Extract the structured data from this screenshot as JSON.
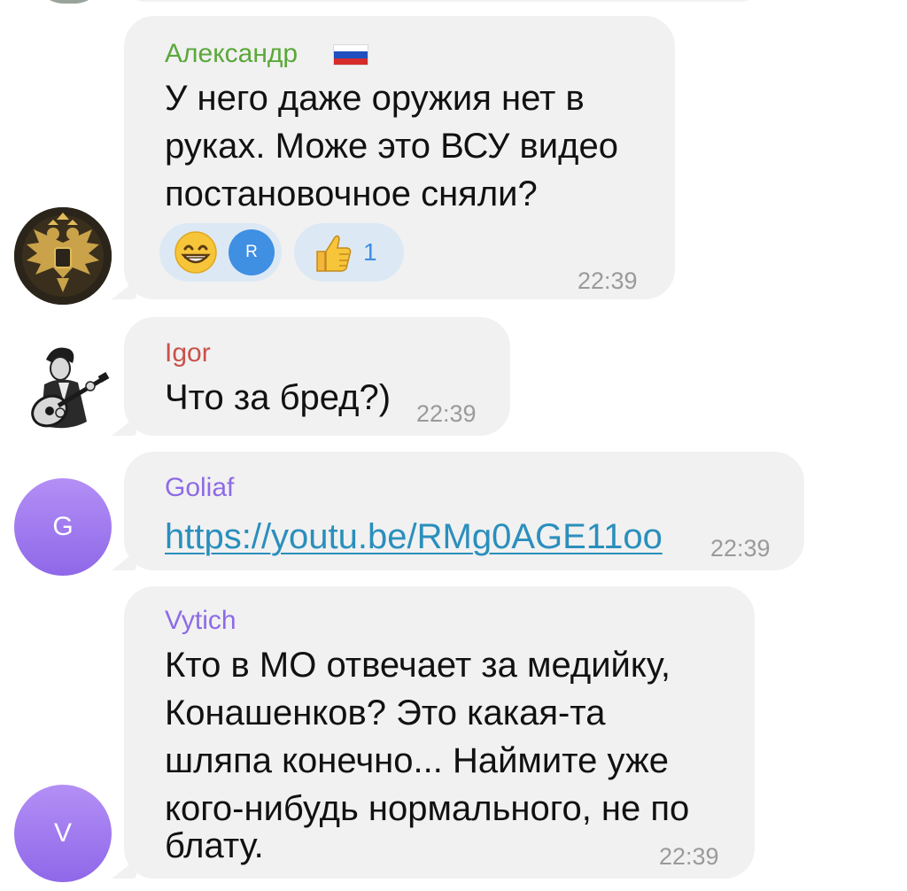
{
  "messages": [
    {
      "sender": "Александр",
      "sender_color": "#5aa83b",
      "sender_flag": "russian-flag",
      "lines": [
        "У него даже оружия нет в",
        "руках. Може это ВСУ видео",
        "постановочное сняли?"
      ],
      "time": "22:39",
      "reactions": [
        {
          "emoji": "grinning-face",
          "reactor_initial": "R"
        },
        {
          "emoji": "thumbs-up",
          "count": "1"
        }
      ],
      "avatar": "double-headed-eagle-emblem"
    },
    {
      "sender": "Igor",
      "sender_color": "#c9524a",
      "lines": [
        "Что за бред?)"
      ],
      "time": "22:39",
      "avatar": "guitar-player-photo"
    },
    {
      "sender": "Goliaf",
      "sender_color": "#8d6be6",
      "link": "https://youtu.be/RMg0AGE11oo",
      "time": "22:39",
      "avatar_initial": "G"
    },
    {
      "sender": "Vytich",
      "sender_color": "#8d6be6",
      "lines": [
        "Кто в МО отвечает за медийку,",
        "Конашенков? Это какая-та",
        "шляпа конечно... Наймите уже",
        "кого-нибудь нормального, не по",
        "блату."
      ],
      "time": "22:39",
      "avatar_initial": "V"
    }
  ]
}
